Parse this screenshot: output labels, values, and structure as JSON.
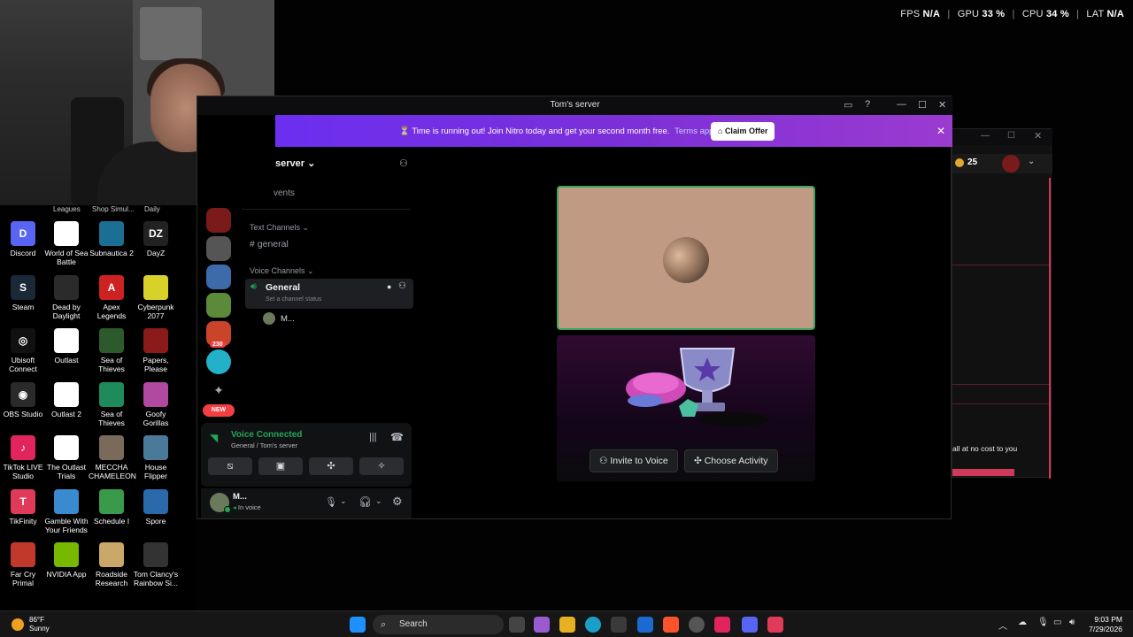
{
  "perf": {
    "fps_label": "FPS",
    "fps": "N/A",
    "gpu_label": "GPU",
    "gpu": "33 %",
    "cpu_label": "CPU",
    "cpu": "34 %",
    "lat_label": "LAT",
    "lat": "N/A"
  },
  "desktop": {
    "cutoff": [
      "Leagues",
      "Shop Simul...",
      "Daily"
    ],
    "icons": [
      {
        "label": "Discord",
        "color": "#5865f2",
        "glyph": "D"
      },
      {
        "label": "World of Sea Battle",
        "color": "#ffffff",
        "glyph": ""
      },
      {
        "label": "Subnautica 2",
        "color": "#1b6f94",
        "glyph": ""
      },
      {
        "label": "DayZ",
        "color": "#222222",
        "glyph": "DZ"
      },
      {
        "label": "Steam",
        "color": "#1b2838",
        "glyph": "S"
      },
      {
        "label": "Dead by Daylight",
        "color": "#2b2b2b",
        "glyph": ""
      },
      {
        "label": "Apex Legends",
        "color": "#cc2222",
        "glyph": "A"
      },
      {
        "label": "Cyberpunk 2077",
        "color": "#d8d12a",
        "glyph": ""
      },
      {
        "label": "Ubisoft Connect",
        "color": "#111111",
        "glyph": "◎"
      },
      {
        "label": "Outlast",
        "color": "#ffffff",
        "glyph": ""
      },
      {
        "label": "Sea of Thieves",
        "color": "#2d5a2d",
        "glyph": ""
      },
      {
        "label": "Papers, Please",
        "color": "#8b1a1a",
        "glyph": ""
      },
      {
        "label": "OBS Studio",
        "color": "#2a2a2a",
        "glyph": "◉"
      },
      {
        "label": "Outlast 2",
        "color": "#ffffff",
        "glyph": ""
      },
      {
        "label": "Sea of Thieves",
        "color": "#1f8a5a",
        "glyph": ""
      },
      {
        "label": "Goofy Gorillas",
        "color": "#b04aa0",
        "glyph": ""
      },
      {
        "label": "TikTok LIVE Studio",
        "color": "#e0245e",
        "glyph": "♪"
      },
      {
        "label": "The Outlast Trials",
        "color": "#ffffff",
        "glyph": ""
      },
      {
        "label": "MECCHA CHAMELEON",
        "color": "#7a6a5a",
        "glyph": ""
      },
      {
        "label": "House Flipper",
        "color": "#4a7a9a",
        "glyph": ""
      },
      {
        "label": "TikFinity",
        "color": "#e03a5a",
        "glyph": "T"
      },
      {
        "label": "Gamble With Your Friends",
        "color": "#3a8ad0",
        "glyph": ""
      },
      {
        "label": "Schedule I",
        "color": "#3a9a4a",
        "glyph": ""
      },
      {
        "label": "Spore",
        "color": "#2a6aaa",
        "glyph": ""
      },
      {
        "label": "Far Cry Primal",
        "color": "#c0392b",
        "glyph": ""
      },
      {
        "label": "NVIDIA App",
        "color": "#76b900",
        "glyph": ""
      },
      {
        "label": "Roadside Research",
        "color": "#c9a86a",
        "glyph": ""
      },
      {
        "label": "Tom Clancy's Rainbow Si...",
        "color": "#333333",
        "glyph": ""
      }
    ]
  },
  "window": {
    "title": "Tom's server"
  },
  "nitro": {
    "message": "Time is running out! Join Nitro today and get your second month free.",
    "terms": "Terms apply.",
    "claim": "Claim Offer"
  },
  "server": {
    "name": "server",
    "events": "vents"
  },
  "guilds": {
    "badge": "230",
    "new": "NEW"
  },
  "channels": {
    "text_category": "Text Channels",
    "text_channel": "general",
    "voice_category": "Voice Channels",
    "voice_channel": "General",
    "voice_status": "Set a channel status",
    "member": "M..."
  },
  "voice": {
    "status": "Voice Connected",
    "location": "General / Tom's server"
  },
  "user": {
    "name": "M...",
    "status": "In voice"
  },
  "stage": {
    "invite": "Invite to Voice",
    "activity": "Choose Activity"
  },
  "window2": {
    "coins": "25",
    "text": "all at no cost to you"
  },
  "taskbar": {
    "temp": "86°F",
    "weather": "Sunny",
    "search": "Search",
    "time": "9:03 PM",
    "date": "7/29/2026"
  }
}
